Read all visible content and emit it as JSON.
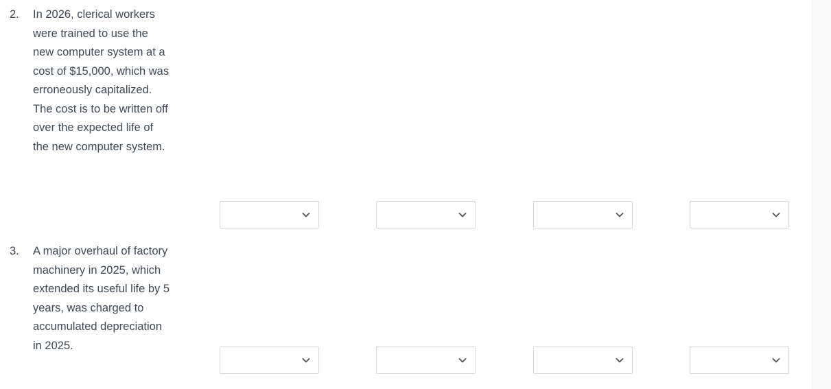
{
  "page": {
    "background_color": "#ffffff",
    "text_color": "#3f4954",
    "border_color": "#d8d8d8",
    "gutter_color": "#f8f8f8"
  },
  "items": [
    {
      "marker": "2.",
      "text": "In 2026, clerical workers were trained to use the new computer system at a cost of $15,000, which was erroneously capitalized. The cost is to be written off over the expected life of the new computer system.",
      "selects": [
        {
          "value": "",
          "icon": "chevron-down-icon"
        },
        {
          "value": "",
          "icon": "chevron-down-icon"
        },
        {
          "value": "",
          "icon": "chevron-down-icon"
        },
        {
          "value": "",
          "icon": "chevron-down-icon"
        }
      ]
    },
    {
      "marker": "3.",
      "text": "A major overhaul of factory machinery in 2025, which extended its useful life by 5 years, was charged to accumulated depreciation in 2025.",
      "selects": [
        {
          "value": "",
          "icon": "chevron-down-icon"
        },
        {
          "value": "",
          "icon": "chevron-down-icon"
        },
        {
          "value": "",
          "icon": "chevron-down-icon"
        },
        {
          "value": "",
          "icon": "chevron-down-icon"
        }
      ]
    }
  ]
}
